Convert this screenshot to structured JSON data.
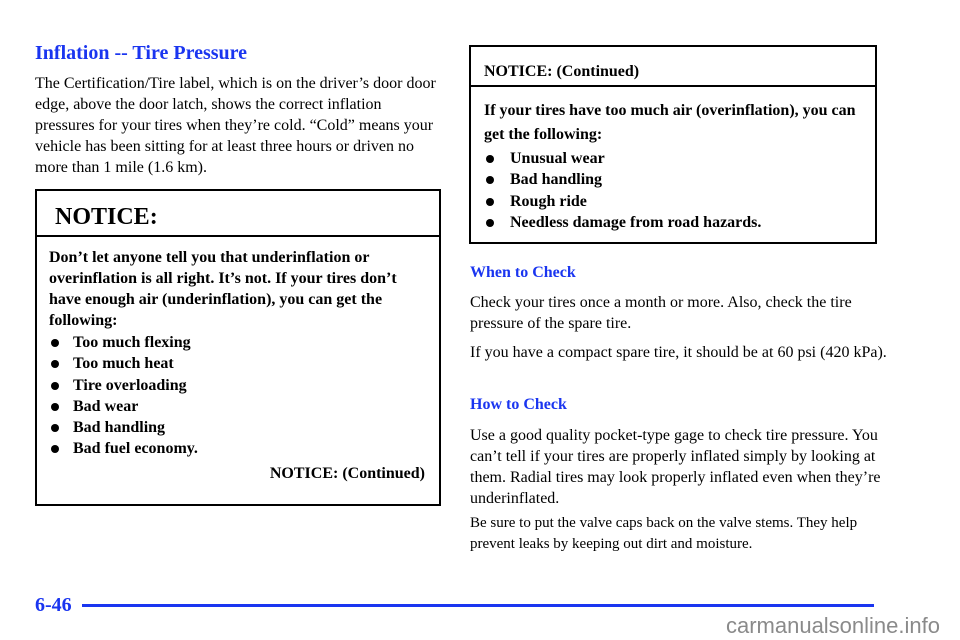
{
  "section_title": "Inflation -- Tire Pressure",
  "intro_paragraph": "The Certification/Tire label, which is on the driver’s door door edge, above the door latch, shows the correct inflation pressures for your tires when they’re cold. “Cold” means your vehicle has been sitting for at least three hours or driven no more than 1 mile (1.6 km).",
  "notice_box": {
    "header": "NOTICE:",
    "text": "Don’t let anyone tell you that underinflation or overinflation is all right. It’s not. If your tires don’t have enough air (underinflation), you can get the following:",
    "bullets": [
      "Too much flexing",
      "Too much heat",
      "Tire overloading",
      "Bad wear",
      "Bad handling",
      "Bad fuel economy."
    ],
    "continued_label": "NOTICE: (Continued)"
  },
  "notice_continued_box": {
    "header": "NOTICE: (Continued)",
    "text": "If your tires have too much air (overinflation), you can get the following:",
    "bullets": [
      "Unusual wear",
      "Bad handling",
      "Rough ride",
      "Needless damage from road hazards."
    ]
  },
  "when_to_check": {
    "heading": "When to Check",
    "paragraphs": [
      "Check your tires once a month or more. Also, check the tire pressure of the spare tire.",
      "If you have a compact spare tire, it should be at 60 psi (420 kPa)."
    ]
  },
  "how_to_check": {
    "heading": "How to Check",
    "paragraphs": [
      "Use a good quality pocket-type gage to check tire pressure. You can’t tell if your tires are properly inflated simply by looking at them. Radial tires may look properly inflated even when they’re underinflated.",
      "Be sure to put the valve caps back on the valve stems. They help prevent leaks by keeping out dirt and moisture."
    ]
  },
  "footer": {
    "page_number": "6-46",
    "watermark": "carmanualsonline.info"
  },
  "colors": {
    "heading_blue": "#1a35f0",
    "watermark_gray": "#8a8a8a"
  }
}
